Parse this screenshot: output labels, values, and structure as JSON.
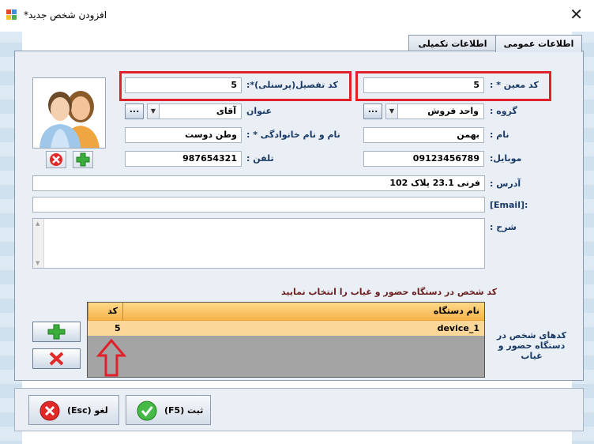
{
  "window": {
    "title": "افزودن شخص جدید*",
    "close_glyph": "✕"
  },
  "tabs": [
    {
      "label": "اطلاعات عمومی",
      "active": true
    },
    {
      "label": "اطلاعات تکمیلی",
      "active": false
    }
  ],
  "form": {
    "code_moein": {
      "label": "کد معین * :",
      "value": "5"
    },
    "code_tafsil": {
      "label": "کد تفصیل(پرسنلی)*:",
      "value": "5"
    },
    "group": {
      "label": "گروه :",
      "value": "واحد فروش",
      "dots": "..."
    },
    "title_field": {
      "label": "عنوان",
      "value": "آقای",
      "dots": "..."
    },
    "first_name": {
      "label": "نام :",
      "value": "بهمن"
    },
    "full_name": {
      "label": "نام و نام خانوادگی * :",
      "value": "وطن دوست"
    },
    "mobile": {
      "label": "موبایل:",
      "value": "09123456789"
    },
    "phone": {
      "label": "تلفن :",
      "value": "987654321"
    },
    "address": {
      "label": "آدرس :",
      "value": "فرنی 23.1 پلاک 102"
    },
    "email": {
      "label": "[Email]:",
      "value": ""
    },
    "description": {
      "label": "شرح :",
      "value": ""
    }
  },
  "devices": {
    "hint": "کد شخص در دستگاه حضور و غیاب را انتخاب نمایید",
    "side_label": "کدهای شخص در دستگاه حضور و غیاب",
    "columns": [
      "نام دستگاه",
      "کد"
    ],
    "rows": [
      {
        "device": "device_1",
        "code": "5"
      }
    ]
  },
  "buttons": {
    "save": "ثبت (F5)",
    "cancel": "لغو (Esc)"
  },
  "colors": {
    "highlight": "#e0202a",
    "grid_header": "#f6b34a",
    "label_text": "#1a3a66"
  }
}
